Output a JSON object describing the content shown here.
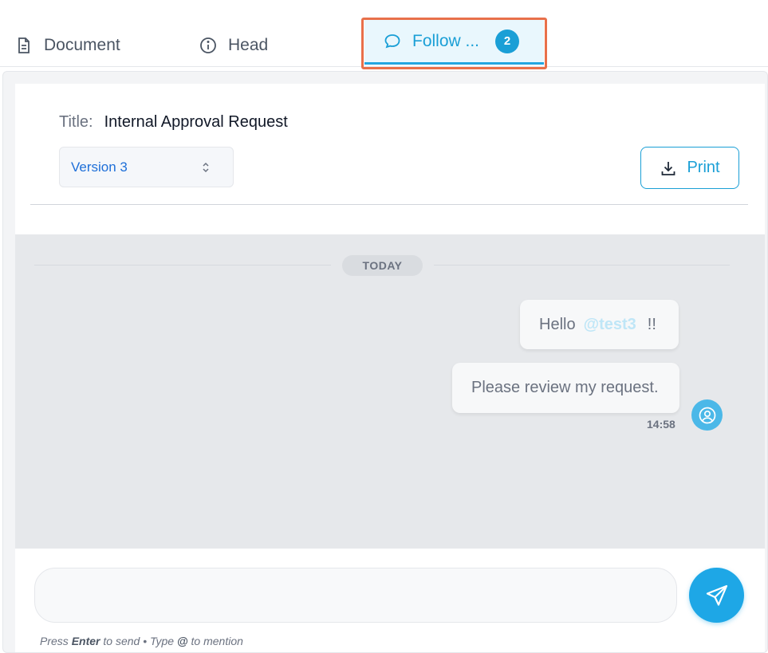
{
  "tabs": [
    {
      "label": "Document",
      "icon": "document-icon"
    },
    {
      "label": "Head",
      "icon": "info-icon"
    },
    {
      "label": "Follow ...",
      "icon": "chat-bubble-icon",
      "badge": "2",
      "active": true
    }
  ],
  "header": {
    "title_label": "Title:",
    "title_value": "Internal Approval Request",
    "version_value": "Version 3",
    "print_label": "Print"
  },
  "chat": {
    "date_separator": "TODAY",
    "messages": [
      {
        "prefix": "Hello",
        "mention": "@test3",
        "suffix": "!!"
      },
      {
        "text": "Please review my request."
      }
    ],
    "time": "14:58"
  },
  "composer": {
    "placeholder": "",
    "hint_press": "Press",
    "hint_enter": "Enter",
    "hint_to_send": "to send •",
    "hint_type": "Type",
    "hint_at": "@",
    "hint_to_mention": "to mention"
  },
  "colors": {
    "accent": "#1a9fd6",
    "focus_ring": "#e8704a",
    "chat_bg": "#e6e8eb",
    "version_text": "#1e6fd8"
  }
}
